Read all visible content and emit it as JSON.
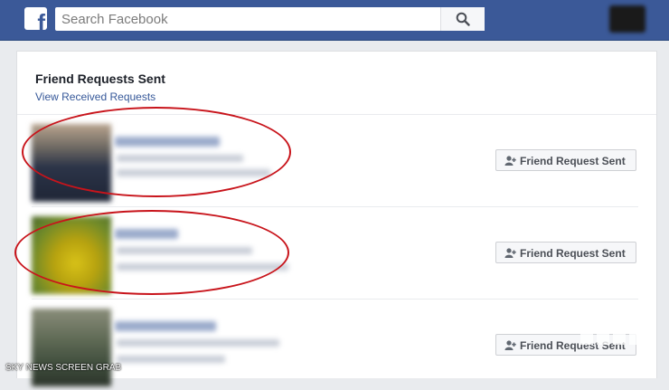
{
  "header": {
    "logo_letter": "f",
    "search_placeholder": "Search Facebook"
  },
  "panel": {
    "title": "Friend Requests Sent",
    "link": "View Received Requests"
  },
  "requests": [
    {
      "button_label": "Friend Request Sent"
    },
    {
      "button_label": "Friend Request Sent"
    },
    {
      "button_label": "Friend Request Sent"
    }
  ],
  "annotation_color": "#c8141b",
  "brand_color": "#3b5998",
  "footer": {
    "credit": "SKY NEWS SCREEN GRAB"
  }
}
